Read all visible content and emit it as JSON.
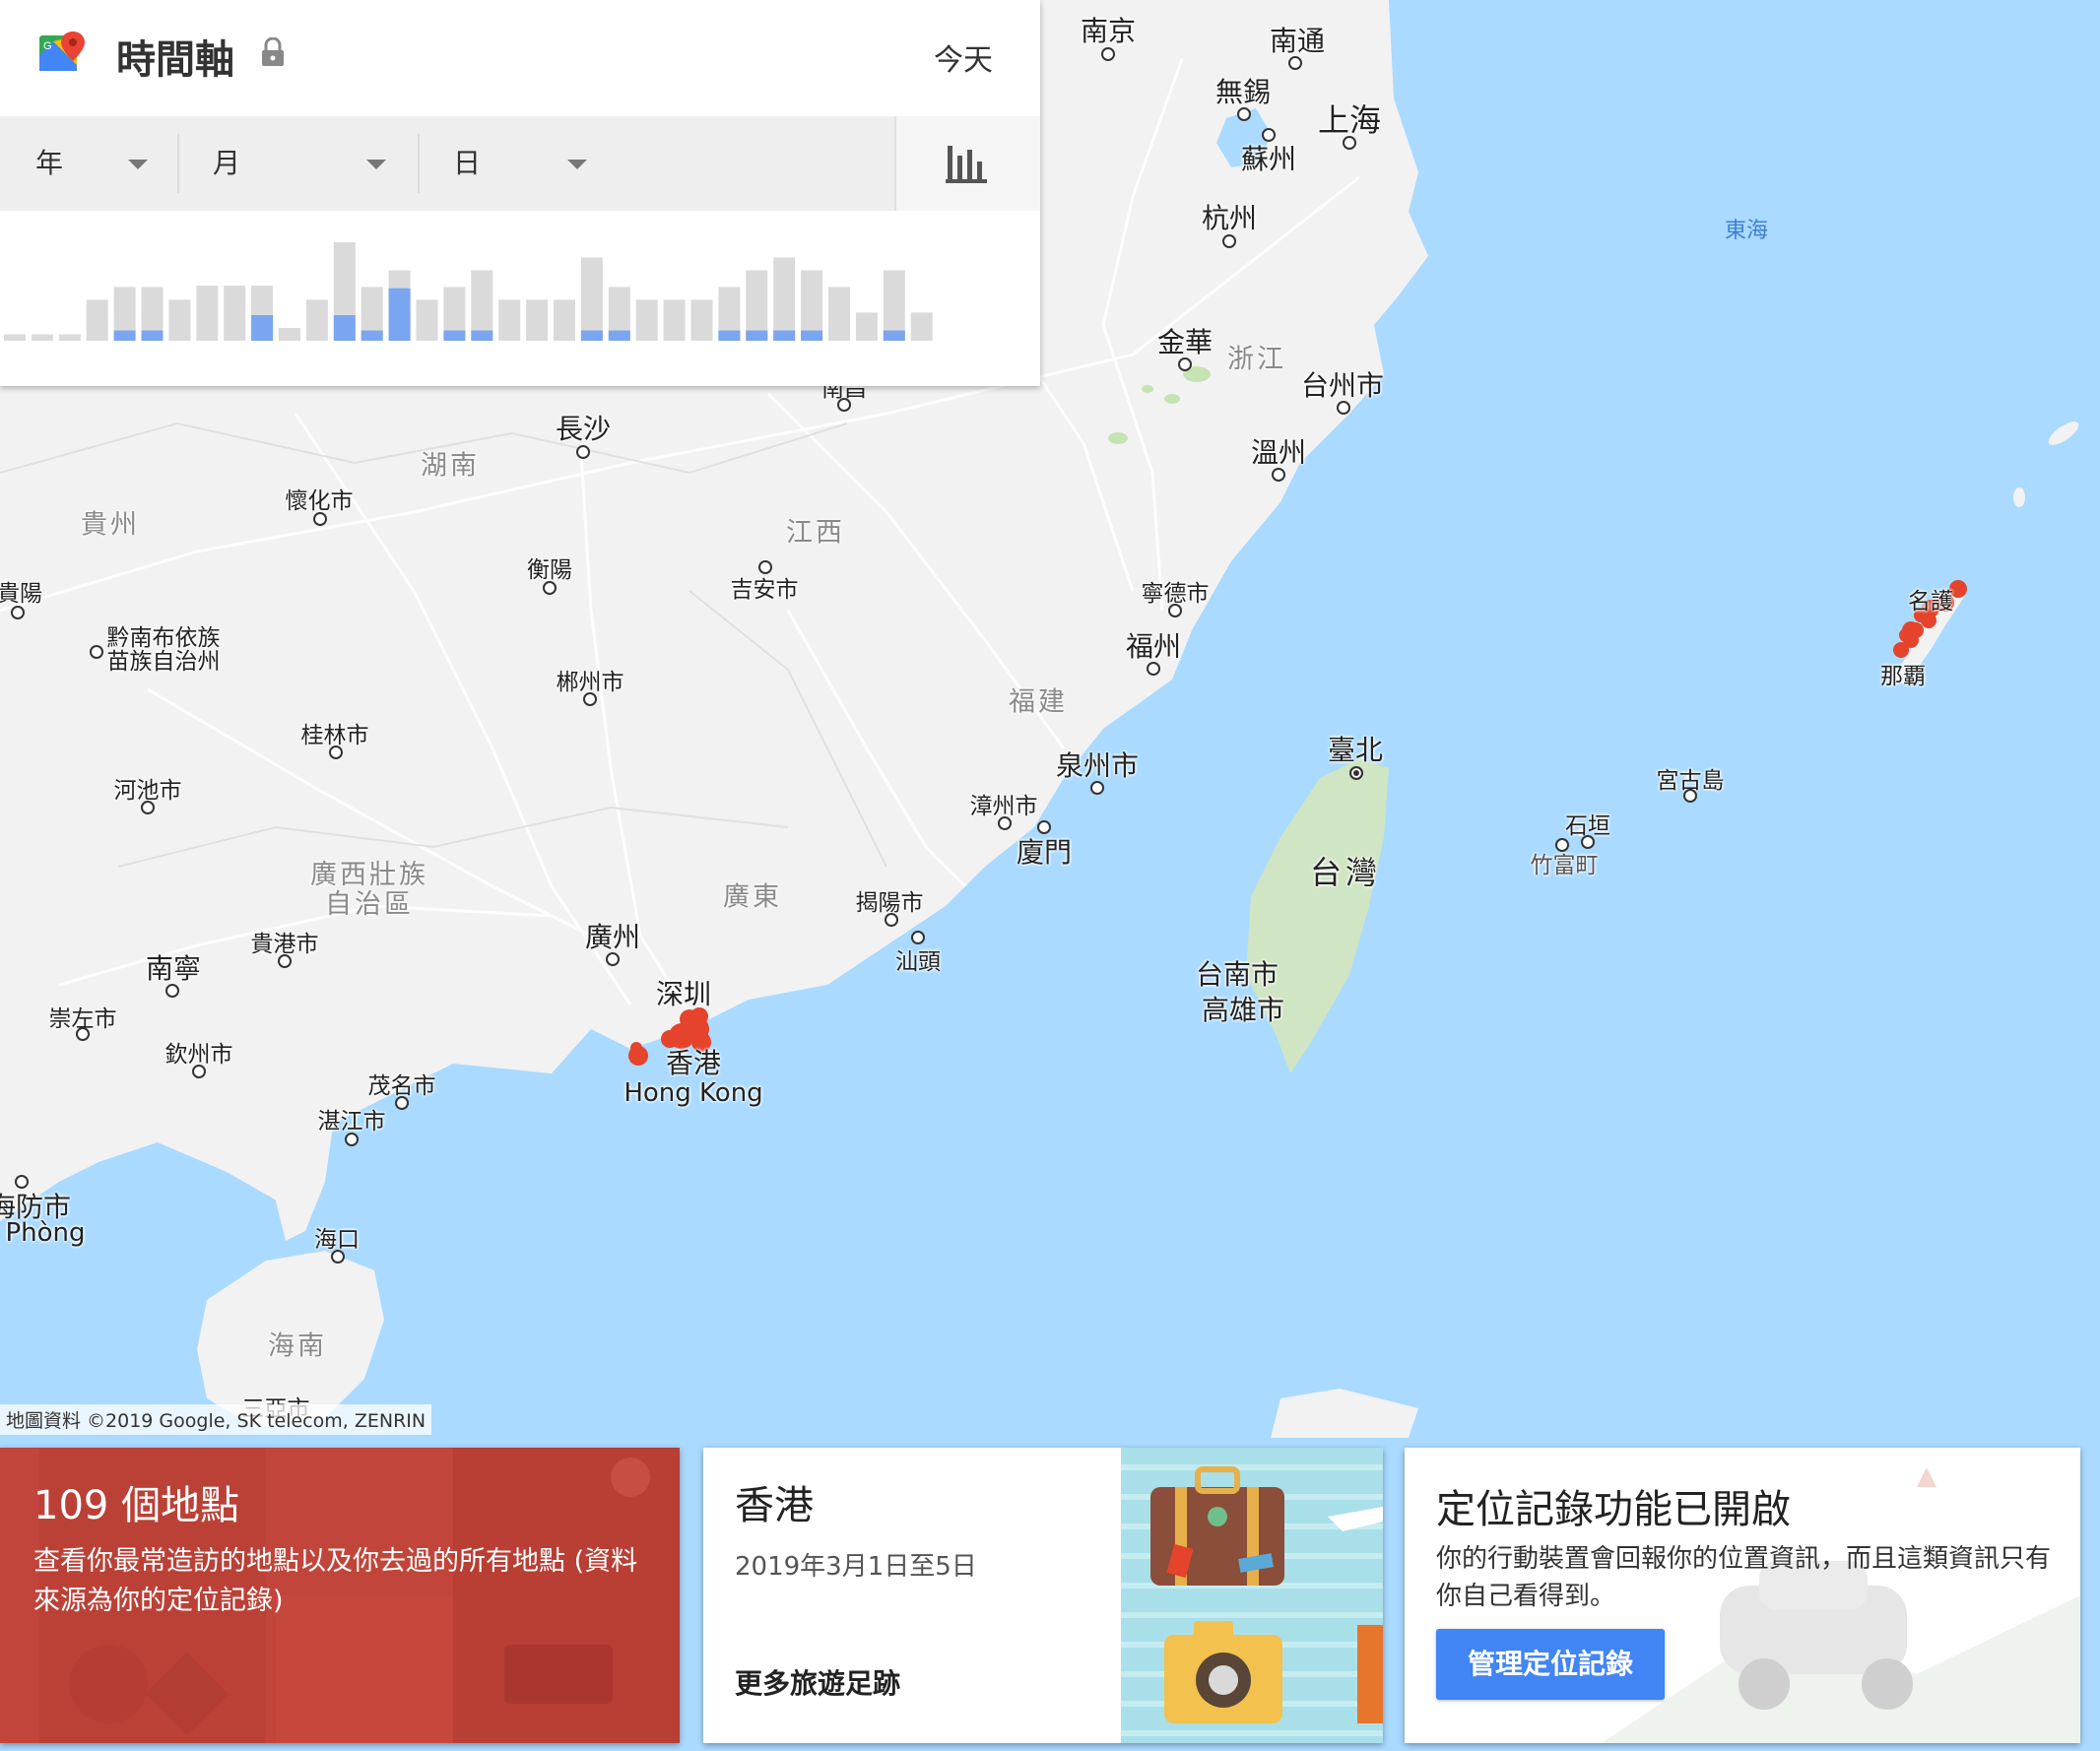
{
  "map": {
    "labels": {
      "nanjing": "南京",
      "nantong": "南通",
      "wuxi": "無錫",
      "shanghai": "上海",
      "suzhou": "蘇州",
      "hangzhou": "杭州",
      "donghai": "東海",
      "jinhua": "金華",
      "zhejiang": "浙江",
      "taizhou": "台州市",
      "wenzhou": "溫州",
      "changsha": "長沙",
      "hunan": "湖南",
      "huaihua": "懷化市",
      "guizhou": "貴州",
      "guiyang": "貴陽",
      "qiannan": "黔南布依族\n苗族自治州",
      "hengyang": "衡陽",
      "jiangxi": "江西",
      "jian": "吉安市",
      "ningde": "寧德市",
      "fuzhou": "福州",
      "chenzhou": "郴州市",
      "fujian": "福建",
      "guilin": "桂林市",
      "quanzhou": "泉州市",
      "hechi": "河池市",
      "zhangzhou": "漳州市",
      "xiamen": "廈門",
      "taipei": "臺北",
      "miyako": "宮古島",
      "ishigaki": "石垣",
      "taketomi": "竹富町",
      "taiwan": "台灣",
      "guangxi": "廣西壯族\n自治區",
      "guangdong": "廣東",
      "jieyang": "揭陽市",
      "shantou": "汕頭",
      "guigang": "貴港市",
      "guangzhou": "廣州",
      "nanning": "南寧",
      "tainan": "台南市",
      "kaohsiung": "高雄市",
      "shenzhen": "深圳",
      "chongzuo": "崇左市",
      "qinzhou": "欽州市",
      "hongkong": "香港",
      "hongkong_en": "Hong Kong",
      "maoming": "茂名市",
      "zhanjiang": "湛江市",
      "haiphong_zh": "海防市",
      "haiphong_vi": "Phòng",
      "haikou": "海口",
      "hainan": "海南",
      "sanya": "三亞市",
      "naha": "那覇",
      "nago": "名護",
      "nanchang": "南昌"
    },
    "credit": "地圖資料 ©2019 Google, SK telecom, ZENRIN",
    "route_color": "#e5432b",
    "land_color": "#f2f2f2",
    "water_color": "#aadaff"
  },
  "panel": {
    "title": "時間軸",
    "lock_icon": "lock-icon",
    "today": "今天",
    "filters": {
      "year": "年",
      "month": "月",
      "day": "日"
    },
    "chart_icon": "bar-chart-icon",
    "activity": [
      0.05,
      0.05,
      0.05,
      0.32,
      0.42,
      0.42,
      0.32,
      0.43,
      0.43,
      0.43,
      0.1,
      0.32,
      0.77,
      0.42,
      0.55,
      0.32,
      0.42,
      0.55,
      0.32,
      0.32,
      0.32,
      0.65,
      0.42,
      0.32,
      0.32,
      0.32,
      0.42,
      0.55,
      0.65,
      0.55,
      0.42,
      0.22,
      0.55,
      0.22
    ],
    "highlight": [
      0,
      0,
      0,
      0,
      0.08,
      0.08,
      0,
      0,
      0,
      0.2,
      0,
      0,
      0.2,
      0.08,
      0.41,
      0,
      0.08,
      0.08,
      0,
      0,
      0,
      0.08,
      0.08,
      0,
      0,
      0,
      0.08,
      0.08,
      0.08,
      0.08,
      0,
      0,
      0.08,
      0
    ],
    "gray_color": "#dadada",
    "blue_color": "#7aa5f0"
  },
  "cards": {
    "places": {
      "title": "109 個地點",
      "desc": "查看你最常造訪的地點以及你去過的所有地點 (資料來源為你的定位記錄)",
      "bg": "#c1453a"
    },
    "trip": {
      "title": "香港",
      "date": "2019年3月1日至5日",
      "link": "更多旅遊足跡"
    },
    "history": {
      "title": "定位記錄功能已開啟",
      "desc": "你的行動裝置會回報你的位置資訊，而且這類資訊只有你自己看得到。",
      "button": "管理定位記錄",
      "button_color": "#4285f4"
    }
  }
}
